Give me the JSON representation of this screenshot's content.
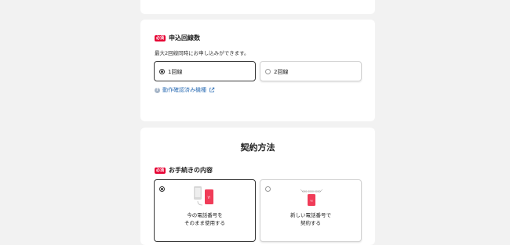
{
  "lines_section": {
    "required_badge": "必須",
    "title": "申込回線数",
    "note": "最大2回線同時にお申し込みができます。",
    "options": [
      {
        "label": "1回線",
        "selected": true
      },
      {
        "label": "2回線",
        "selected": false
      }
    ],
    "link_icon": "question-circle-icon",
    "link_text": "動作確認済み機種",
    "link_ext_icon": "external-link-icon"
  },
  "contract_section": {
    "title": "契約方法",
    "required_badge": "必須",
    "field_title": "お手続きの内容",
    "options": [
      {
        "line1": "今の電話番号を",
        "line2": "そのまま使用する",
        "selected": true,
        "illustration": "phone-transfer-illustration"
      },
      {
        "line1": "新しい電話番号で",
        "line2": "契約する",
        "selected": false,
        "illustration": "new-number-illustration",
        "illustration_text": "090-0000-0000"
      }
    ]
  },
  "colors": {
    "accent_red": "#e60033",
    "link_blue": "#2f6fb5",
    "page_bg": "#f2f2f2"
  }
}
